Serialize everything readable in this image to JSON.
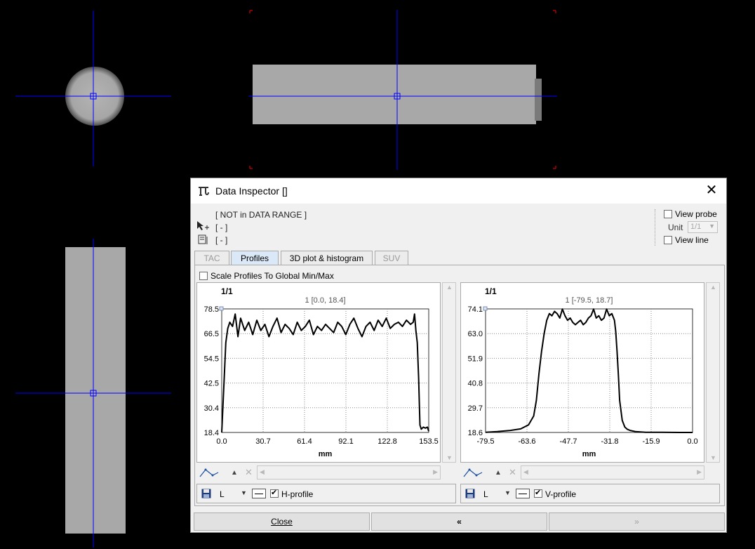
{
  "dialog": {
    "title": "Data Inspector []",
    "status": "[ NOT in DATA RANGE ]",
    "value_line_1": "[ - ]",
    "value_line_2": "[ - ]",
    "view_probe_label": "View probe",
    "unit_label": "Unit",
    "unit_value": "1/1",
    "view_line_label": "View line",
    "tabs": [
      {
        "label": "TAC",
        "state": "disabled"
      },
      {
        "label": "Profiles",
        "state": "active"
      },
      {
        "label": "3D plot & histogram",
        "state": "normal"
      },
      {
        "label": "SUV",
        "state": "disabled"
      }
    ],
    "scale_profiles_label": "Scale Profiles To Global Min/Max",
    "buttons": {
      "close": "Close",
      "prev": "«",
      "next": "»"
    }
  },
  "profiles": [
    {
      "slice_label": "1/1",
      "line_style": "L",
      "profile_label": "H-profile",
      "profile_checked": true
    },
    {
      "slice_label": "1/1",
      "line_style": "L",
      "profile_label": "V-profile",
      "profile_checked": true
    }
  ],
  "chart_data": [
    {
      "type": "line",
      "title": "1 [0.0, 18.4]",
      "xlabel": "mm",
      "ylabel": "",
      "xlim": [
        0.0,
        153.5
      ],
      "ylim": [
        18.4,
        78.5
      ],
      "xticks": [
        "0.0",
        "30.7",
        "61.4",
        "92.1",
        "122.8",
        "153.5"
      ],
      "yticks": [
        "78.5",
        "66.5",
        "54.5",
        "42.5",
        "30.4",
        "18.4"
      ],
      "grid": true,
      "series": [
        {
          "x": [
            0,
            1.5,
            3,
            4.5,
            6,
            8,
            10,
            12,
            14,
            17,
            20,
            23,
            26,
            29,
            32,
            35,
            38,
            41,
            44,
            47,
            50,
            53,
            56,
            59,
            62,
            65,
            68,
            71,
            74,
            77,
            80,
            83,
            86,
            89,
            92,
            95,
            98,
            101,
            104,
            107,
            110,
            113,
            116,
            119,
            122,
            125,
            128,
            131,
            134,
            137,
            140,
            142,
            143,
            144,
            145,
            146,
            147,
            148,
            149.5,
            151,
            152.5,
            153.5
          ],
          "y": [
            18.4,
            40,
            62,
            69,
            72,
            70,
            76,
            65,
            74,
            68,
            72,
            66,
            73,
            68,
            71,
            65,
            70,
            74,
            67,
            71,
            69,
            66,
            72,
            68,
            70,
            73,
            66,
            70,
            68,
            71,
            69,
            67,
            72,
            70,
            66,
            71,
            74,
            69,
            65,
            70,
            72,
            68,
            73,
            70,
            74,
            69,
            71,
            72,
            70,
            73,
            71,
            72,
            76,
            68,
            62,
            45,
            22,
            20,
            21,
            20.5,
            21,
            19
          ]
        }
      ]
    },
    {
      "type": "line",
      "title": "1 [-79.5, 18.7]",
      "xlabel": "mm",
      "ylabel": "",
      "xlim": [
        -79.5,
        0.0
      ],
      "ylim": [
        18.6,
        74.1
      ],
      "xticks": [
        "-79.5",
        "-63.6",
        "-47.7",
        "-31.8",
        "-15.9",
        "0.0"
      ],
      "yticks": [
        "74.1",
        "63.0",
        "51.9",
        "40.8",
        "29.7",
        "18.6"
      ],
      "grid": true,
      "series": [
        {
          "x": [
            -79.5,
            -75,
            -70,
            -66,
            -63,
            -61,
            -60,
            -59,
            -58,
            -57,
            -56,
            -55,
            -54,
            -53,
            -52,
            -51,
            -50,
            -49,
            -48,
            -47,
            -46,
            -45,
            -44,
            -43,
            -42,
            -41,
            -40,
            -39,
            -38,
            -37,
            -36,
            -35,
            -34,
            -33,
            -32,
            -31,
            -30,
            -29.5,
            -29,
            -28.5,
            -28,
            -27,
            -26,
            -25,
            -24,
            -22,
            -18,
            -12,
            -5,
            0
          ],
          "y": [
            18.7,
            19,
            19.5,
            20.2,
            22,
            26,
            33,
            45,
            55,
            63,
            69,
            72,
            71,
            73,
            72,
            70,
            74,
            71,
            69,
            70,
            68,
            67,
            68,
            69,
            67,
            68,
            70,
            71,
            74,
            70,
            71,
            69,
            70,
            74,
            71,
            72,
            69,
            64,
            55,
            45,
            33,
            24,
            21,
            20,
            19.5,
            19,
            18.7,
            18.7,
            18.6,
            18.6
          ]
        }
      ]
    }
  ]
}
